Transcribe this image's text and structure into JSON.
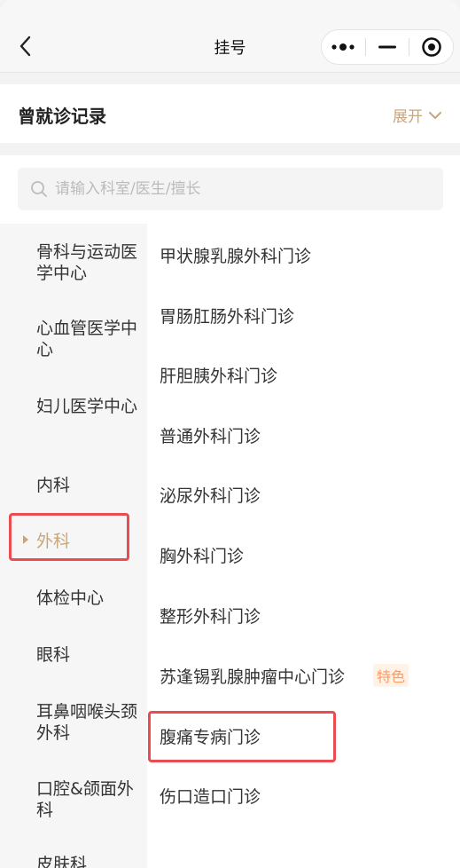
{
  "nav": {
    "title": "挂号"
  },
  "history": {
    "title": "曾就诊记录",
    "expand_label": "展开"
  },
  "search": {
    "placeholder": "请输入科室/医生/擅长"
  },
  "departments": [
    {
      "label": "骨科与运动医学中心"
    },
    {
      "label": "心血管医学中心"
    },
    {
      "label": "妇儿医学中心"
    },
    {
      "label": "内科"
    },
    {
      "label": "外科",
      "selected": true
    },
    {
      "label": "体检中心"
    },
    {
      "label": "眼科"
    },
    {
      "label": "耳鼻咽喉头颈外科"
    },
    {
      "label": "口腔&颌面外科"
    },
    {
      "label": "皮肤科"
    }
  ],
  "clinics": [
    {
      "label": "甲状腺乳腺外科门诊"
    },
    {
      "label": "胃肠肛肠外科门诊"
    },
    {
      "label": "肝胆胰外科门诊"
    },
    {
      "label": "普通外科门诊"
    },
    {
      "label": "泌尿外科门诊"
    },
    {
      "label": "胸外科门诊"
    },
    {
      "label": "整形外科门诊"
    },
    {
      "label": "苏逢锡乳腺肿瘤中心门诊",
      "tag": "特色"
    },
    {
      "label": "腹痛专病门诊"
    },
    {
      "label": "伤口造口门诊"
    }
  ],
  "icons": {
    "back": "chevron-left-icon",
    "more": "more-dots-icon",
    "minimize": "minimize-icon",
    "close": "target-circle-icon",
    "expand": "chevron-down-icon",
    "search": "search-icon"
  },
  "colors": {
    "accent": "#c8a67a",
    "tag_text": "#ff9b62",
    "highlight_box": "#ea4c4f"
  }
}
